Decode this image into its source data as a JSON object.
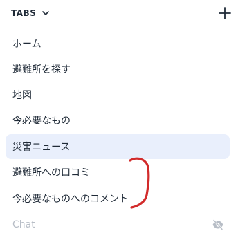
{
  "tabs_header": {
    "title": "TABS"
  },
  "items": [
    {
      "label": "ホーム",
      "state": "default"
    },
    {
      "label": "避難所を探す",
      "state": "default"
    },
    {
      "label": "地図",
      "state": "default"
    },
    {
      "label": "今必要なもの",
      "state": "default"
    },
    {
      "label": "災害ニュース",
      "state": "active"
    },
    {
      "label": "避難所への口コミ",
      "state": "default"
    },
    {
      "label": "今必要なものへのコメント",
      "state": "default"
    },
    {
      "label": "Chat",
      "state": "muted"
    }
  ],
  "icons": {
    "chevron": "chevron-down-icon",
    "add": "plus-icon",
    "hidden": "eye-off-icon"
  },
  "colors": {
    "active_bg": "#e9effc",
    "text": "#1f2a37",
    "muted": "#b7bdc6",
    "annotation": "#d22b2b"
  }
}
